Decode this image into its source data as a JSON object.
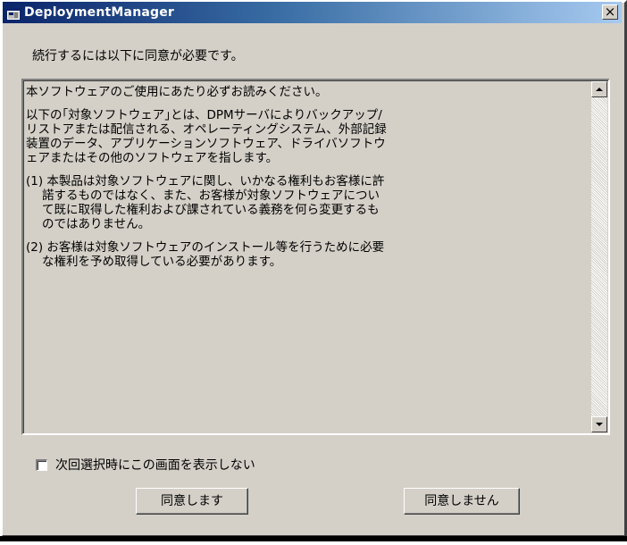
{
  "window": {
    "title": "DeploymentManager",
    "close_glyph": "×",
    "title_icon": "app-icon",
    "close_icon": "close-icon"
  },
  "dialog": {
    "instruction": "続行するには以下に同意が必要です。",
    "license_paragraphs": [
      "本ソフトウェアのご使用にあたり必ずお読みください。",
      "以下の｢対象ソフトウェア｣とは、DPMサーバによりバックアップ/\nリストアまたは配信される、オペレーティングシステム、外部記録\n装置のデータ、アプリケーションソフトウェア、ドライバソフトウ\nェアまたはその他のソフトウェアを指します。",
      "(1) 本製品は対象ソフトウェアに関し、いかなる権利もお客様に許\n諾するものではなく、また、お客様が対象ソフトウェアについ\nて既に取得した権利および課されている義務を何ら変更するも\nのではありません。",
      "(2) お客様は対象ソフトウェアのインストール等を行うために必要\nな権利を予め取得している必要があります。"
    ],
    "checkbox_label": "次回選択時にこの画面を表示しない",
    "checkbox_checked": false,
    "agree_label": "同意します",
    "disagree_label": "同意しません"
  },
  "colors": {
    "title_gradient_start": "#0a246a",
    "title_gradient_end": "#a6caf0",
    "dialog_face": "#d4d0c8"
  }
}
